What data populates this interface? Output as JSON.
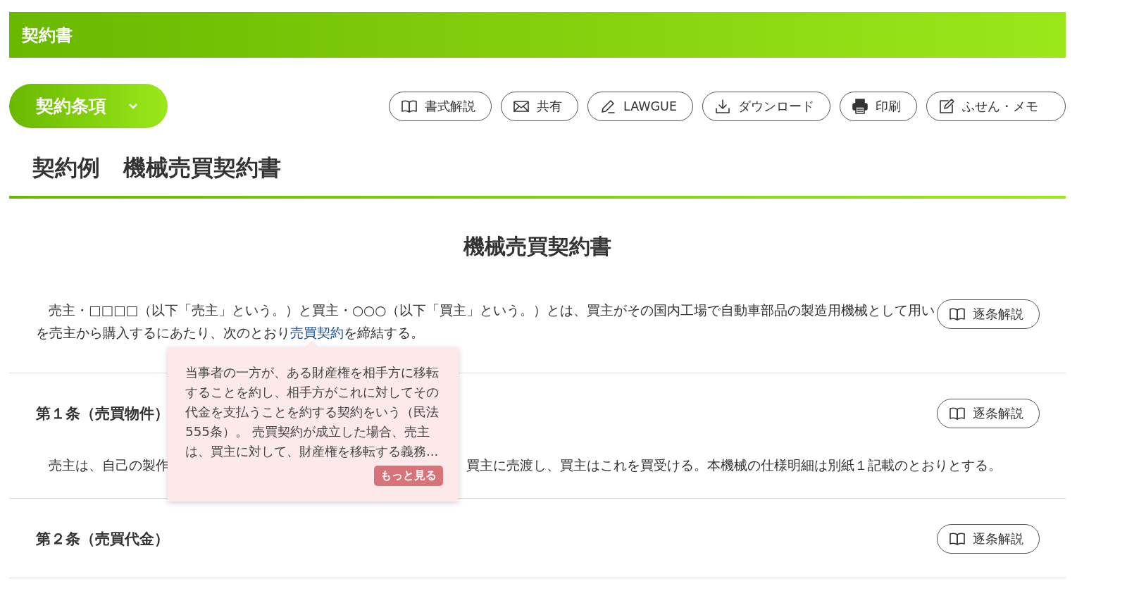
{
  "header": {
    "title": "契約書"
  },
  "section_dropdown": {
    "label": "契約条項"
  },
  "toolbar": [
    {
      "kind": "book",
      "label": "書式解説"
    },
    {
      "kind": "mail",
      "label": "共有"
    },
    {
      "kind": "pen",
      "label": "LAWGUE"
    },
    {
      "kind": "download",
      "label": "ダウンロード"
    },
    {
      "kind": "print",
      "label": "印刷"
    },
    {
      "kind": "note",
      "label": "ふせん・メモ"
    }
  ],
  "page_heading": {
    "label": "契約例",
    "title": "機械売買契約書"
  },
  "document": {
    "title": "機械売買契約書",
    "preamble": {
      "line_1": "売主・□□□□（以下「売主」という。）と買主・○○○（以下「買主」という。）とは、買主がその国内工場で自動車部品の製造用機械として用い",
      "line_2_before": "を売主から購入するにあたり、次のとおり",
      "link": "売買契約",
      "line_2_after": "を締結する。",
      "button": "逐条解説"
    },
    "articles": [
      {
        "heading": "第１条（売買物件）",
        "button": "逐条解説",
        "body": [
          "売主は、自己の製作",
          "買主に売渡し、買主はこれを買受ける。本機械の仕様明細は別紙１記載のとおりとする。"
        ]
      },
      {
        "heading": "第２条（売買代金）",
        "button": "逐条解説"
      }
    ],
    "tooltip": {
      "text": "当事者の一方が、ある財産権を相手方に移転することを約し、相手方がこれに対してその代金を支払うことを約する契約をいう（民法555条）。 売買契約が成立した場合、売主は、買主に対して、財産権を移転する義務...",
      "more_button": "もっと見る"
    }
  }
}
